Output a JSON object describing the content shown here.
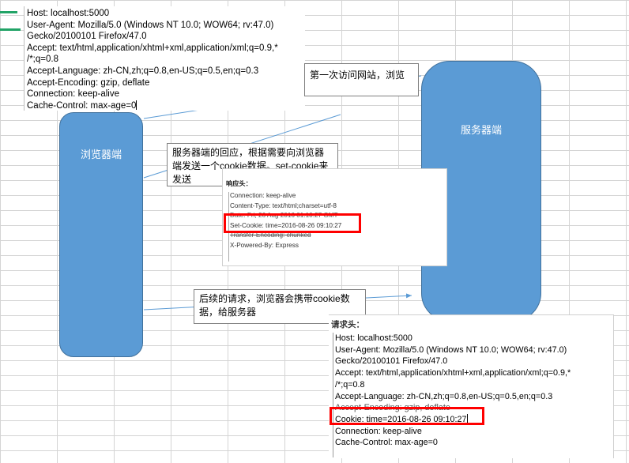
{
  "nodes": {
    "browser": "浏览器端",
    "server": "服务器端"
  },
  "first_request_headers": [
    "Host: localhost:5000",
    "User-Agent: Mozilla/5.0 (Windows NT 10.0; WOW64; rv:47.0)",
    "Gecko/20100101 Firefox/47.0",
    "Accept: text/html,application/xhtml+xml,application/xml;q=0.9,*",
    "/*;q=0.8",
    "Accept-Language: zh-CN,zh;q=0.8,en-US;q=0.5,en;q=0.3",
    "Accept-Encoding: gzip, deflate",
    "Connection: keep-alive",
    "Cache-Control: max-age=0"
  ],
  "captions": {
    "first_visit": "第一次访问网站，浏览",
    "server_reply": "服务器端的回应，根据需要向浏览器端发送一个cookie数据。set-cookie来发送",
    "subsequent": "后续的请求，浏览器会携带cookie数据，给服务器"
  },
  "response_panel": {
    "title": "响应头：",
    "lines": [
      "Connection: keep-alive",
      "Content-Type: text/html;charset=utf-8",
      "Date: Fri, 26 Aug 2016 01:10:27 GMT",
      "Set-Cookie: time=2016-08-26 09:10:27",
      "Transfer-Encoding: chunked",
      "X-Powered-By: Express"
    ]
  },
  "request_panel": {
    "title": "请求头：",
    "lines": [
      "Host: localhost:5000",
      "User-Agent: Mozilla/5.0 (Windows NT 10.0; WOW64; rv:47.0)",
      "Gecko/20100101 Firefox/47.0",
      "Accept: text/html,application/xhtml+xml,application/xml;q=0.9,*",
      "/*;q=0.8",
      "Accept-Language: zh-CN,zh;q=0.8,en-US;q=0.5,en;q=0.3",
      "Accept-Encoding: gzip, deflate",
      "Cookie: time=2016-08-26 09:10:27",
      "Connection: keep-alive",
      "Cache-Control: max-age=0"
    ]
  },
  "colors": {
    "node_fill": "#5b9bd5",
    "node_border": "#41719c",
    "highlight": "#ff0000",
    "connector": "#5b9bd5",
    "sheet_accent": "#21a366"
  }
}
